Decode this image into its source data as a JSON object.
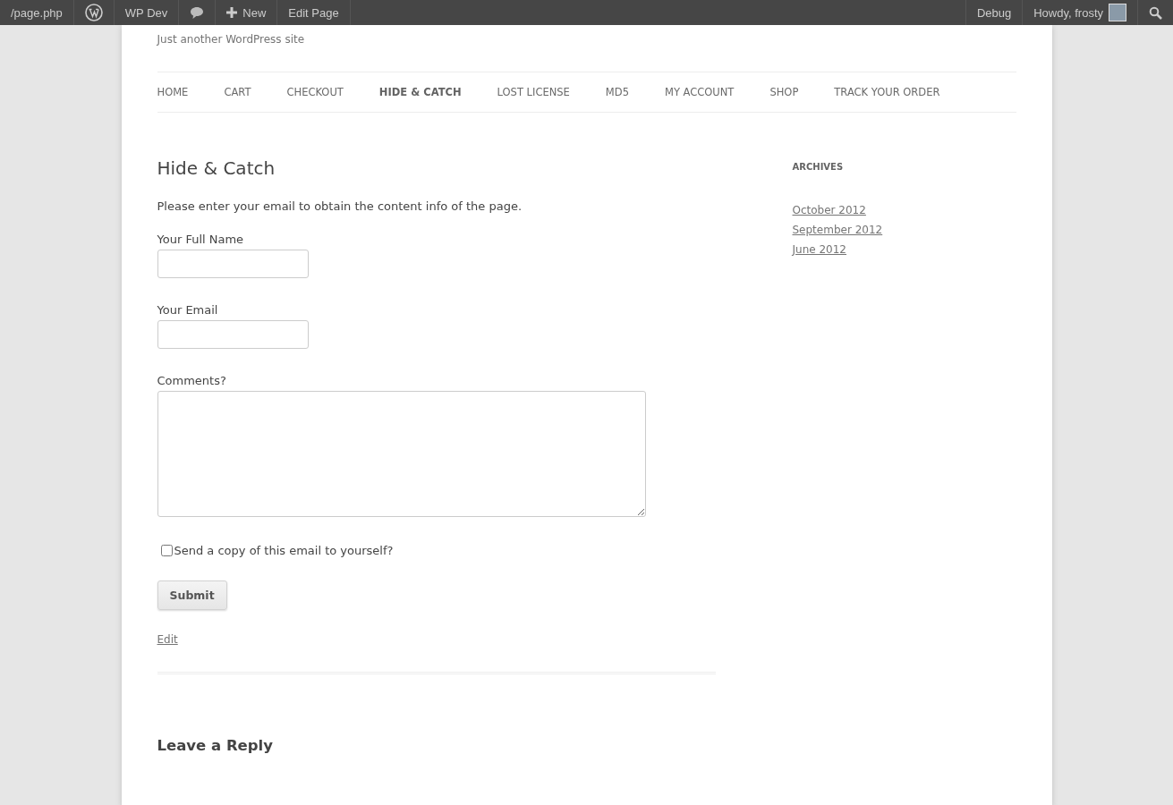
{
  "admin_bar": {
    "left": [
      {
        "kind": "text",
        "label": "/page.php"
      },
      {
        "kind": "logo"
      },
      {
        "kind": "text",
        "label": "WP Dev"
      },
      {
        "kind": "comments"
      },
      {
        "kind": "new",
        "label": "New"
      },
      {
        "kind": "text",
        "label": "Edit Page"
      }
    ],
    "right": [
      {
        "kind": "text",
        "label": "Debug"
      },
      {
        "kind": "account",
        "label": "Howdy, frosty"
      },
      {
        "kind": "search"
      }
    ]
  },
  "site": {
    "tagline": "Just another WordPress site"
  },
  "nav": [
    {
      "label": "HOME",
      "selected": false
    },
    {
      "label": "CART",
      "selected": false
    },
    {
      "label": "CHECKOUT",
      "selected": false
    },
    {
      "label": "HIDE & CATCH",
      "selected": true
    },
    {
      "label": "LOST LICENSE",
      "selected": false
    },
    {
      "label": "MD5",
      "selected": false
    },
    {
      "label": "MY ACCOUNT",
      "selected": false
    },
    {
      "label": "SHOP",
      "selected": false
    },
    {
      "label": "TRACK YOUR ORDER",
      "selected": false
    }
  ],
  "page": {
    "title": "Hide & Catch",
    "intro": "Please enter your email to obtain the content info of the page.",
    "fields": [
      {
        "kind": "input",
        "label": "Your Full Name"
      },
      {
        "kind": "input",
        "label": "Your Email"
      },
      {
        "kind": "textarea",
        "label": "Comments?"
      }
    ],
    "copy_checkbox": {
      "label": "Send a copy of this email to yourself?",
      "checked": false
    },
    "submit": "Submit",
    "edit_link": "Edit",
    "reply_heading": "Leave a Reply"
  },
  "sidebar": {
    "title": "ARCHIVES",
    "links": [
      "October 2012",
      "September 2012",
      "June 2012"
    ]
  }
}
